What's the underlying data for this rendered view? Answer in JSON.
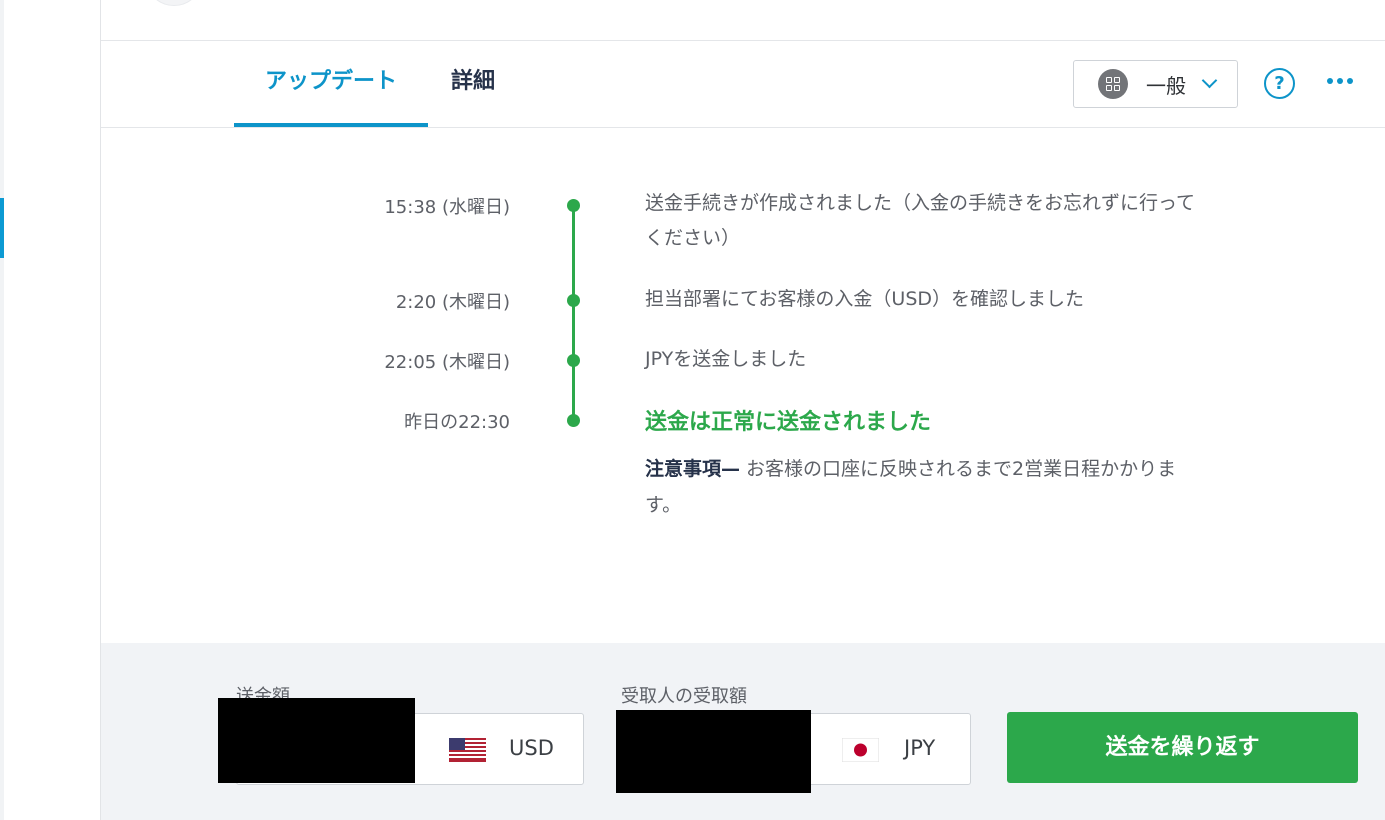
{
  "tabs": {
    "updates": "アップデート",
    "details": "詳細"
  },
  "view_selector": {
    "label": "一般",
    "icon": "grid-icon"
  },
  "toolbar": {
    "help_icon": "question-circle-icon",
    "help_glyph": "?",
    "more_icon": "ellipsis-icon"
  },
  "timeline": [
    {
      "time": "15:38 (水曜日)",
      "text": "送金手続きが作成されました（入金の手続きをお忘れずに行ってください）"
    },
    {
      "time": "2:20 (木曜日)",
      "text": "担当部署にてお客様の入金（USD）を確認しました"
    },
    {
      "time": "22:05 (木曜日)",
      "text": "JPYを送金しました"
    },
    {
      "time": "昨日の22:30",
      "text": "送金は正常に送金されました"
    }
  ],
  "note": {
    "label": "注意事項—",
    "text": " お客様の口座に反映されるまで2営業日程かかります。"
  },
  "send": {
    "label": "送金額",
    "currency": "USD",
    "flag": "us-flag-icon"
  },
  "receive": {
    "label": "受取人の受取額",
    "currency": "JPY",
    "flag": "jp-flag-icon"
  },
  "repeat_button": "送金を繰り返す",
  "colors": {
    "accent": "#0d94c9",
    "success": "#2ca84b",
    "footer_bg": "#f1f3f6"
  }
}
